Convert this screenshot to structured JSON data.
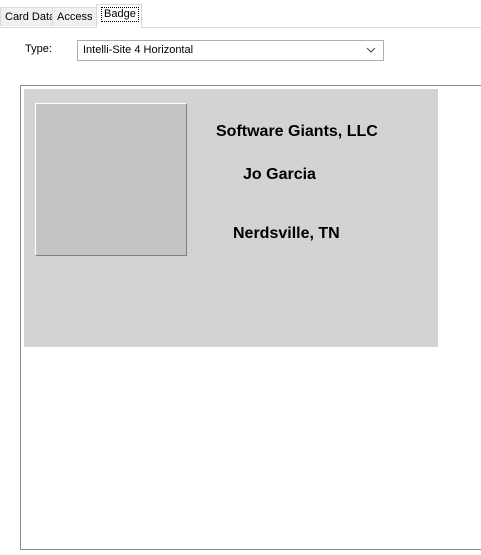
{
  "tabs": [
    {
      "label": "Card Data",
      "active": false
    },
    {
      "label": "Access",
      "active": false
    },
    {
      "label": "Badge",
      "active": true
    }
  ],
  "badge_page": {
    "type_label": "Type:",
    "type_value": "Intelli-Site 4 Horizontal"
  },
  "badge": {
    "company": "Software Giants, LLC",
    "name": "Jo Garcia",
    "location": "Nerdsville, TN",
    "background_color": "#d3d3d3",
    "photo_placeholder_color": "#c4c4c4"
  },
  "icons": {
    "dropdown": "chevron-down-icon"
  }
}
